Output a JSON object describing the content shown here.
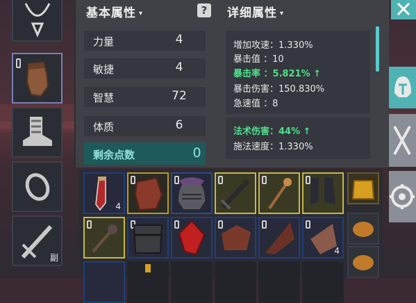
{
  "headers": {
    "basic": "基本属性",
    "detail": "详细属性",
    "help_label": "?"
  },
  "basic_stats": [
    {
      "label": "力量",
      "value": "4"
    },
    {
      "label": "敏捷",
      "value": "4"
    },
    {
      "label": "智慧",
      "value": "72"
    },
    {
      "label": "体质",
      "value": "6"
    }
  ],
  "remaining": {
    "label": "剩余点数",
    "value": "0"
  },
  "detail_box1": [
    {
      "text": "增加攻速：1.330%",
      "highlight": false
    },
    {
      "text": "暴击值 ：10",
      "highlight": false
    },
    {
      "text": "暴击率 ：5.821% ↑",
      "highlight": true
    },
    {
      "text": "暴击伤害：150.830%",
      "highlight": false
    },
    {
      "text": "急速值 ：8",
      "highlight": false
    }
  ],
  "detail_box2": [
    {
      "text": "法术伤害：44% ↑",
      "highlight": true
    },
    {
      "text": "施法速度：1.330%",
      "highlight": false
    }
  ],
  "equipment": {
    "offhand_tag": "副"
  },
  "inventory": {
    "row1": [
      {
        "item": "red-potion",
        "qty": "4"
      },
      {
        "item": "leather-armor"
      },
      {
        "item": "iron-helmet"
      },
      {
        "item": "black-sword"
      },
      {
        "item": "wooden-staff"
      },
      {
        "item": "dark-boots"
      }
    ],
    "row2": [
      {
        "item": "spiked-mace"
      },
      {
        "item": "chest-armor"
      },
      {
        "item": "red-crystal"
      },
      {
        "item": "brown-cloth"
      },
      {
        "item": "brown-shard"
      },
      {
        "item": "brown-hide",
        "qty": "4"
      }
    ]
  },
  "icons": {
    "close": "close-icon",
    "helmet_tab": "helmet-icon",
    "weapons_tab": "crossed-swords-icon",
    "settings_tab": "gear-icon"
  },
  "colors": {
    "accent_teal": "#4fb3b3",
    "highlight_green": "#4fe08a",
    "remaining_bg": "#1f5a5b"
  }
}
